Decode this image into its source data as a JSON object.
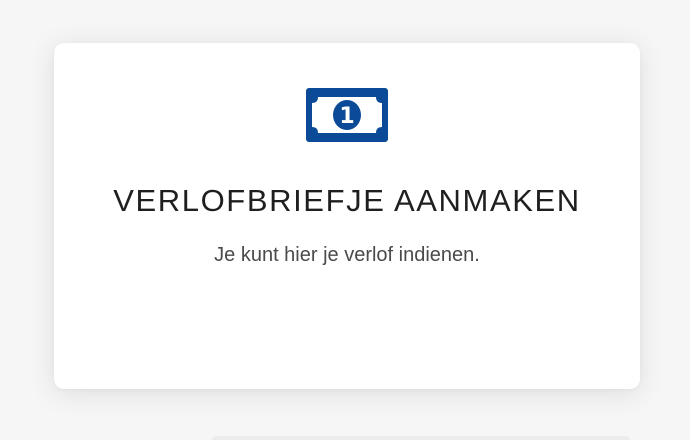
{
  "card": {
    "icon": "money-bill-icon",
    "icon_digit": "1",
    "title": "VERLOFBRIEFJE AANMAKEN",
    "description": "Je kunt hier je verlof indienen."
  },
  "colors": {
    "icon_blue": "#0b4a97",
    "background": "#f6f6f6",
    "card_background": "#ffffff",
    "title_text": "#1f1f1f",
    "description_text": "#4a4a4a"
  }
}
